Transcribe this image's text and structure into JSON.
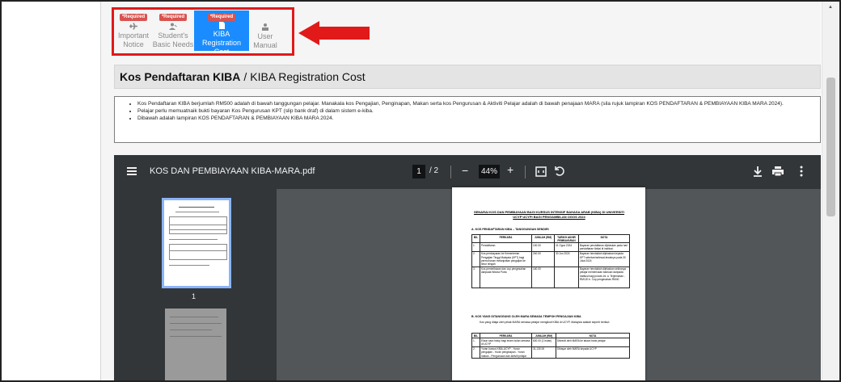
{
  "tabs": [
    {
      "badge": "*Required",
      "label_1": "Important",
      "label_2": "Notice",
      "icon": "plane-icon",
      "active": false
    },
    {
      "badge": "*Required",
      "label_1": "Student's",
      "label_2": "Basic Needs",
      "icon": "user-icon",
      "active": false
    },
    {
      "badge": "*Required",
      "label_1": "KIBA",
      "label_2": "Registration Cost",
      "icon": "document-icon",
      "active": true
    },
    {
      "badge": "",
      "label_1": "User",
      "label_2": "Manual",
      "icon": "user-manual-icon",
      "active": false
    }
  ],
  "title": {
    "bold": "Kos Pendaftaran KIBA",
    "sep": "/",
    "rest": "KIBA Registration Cost"
  },
  "info": {
    "items": [
      "Kos Pendaftaran KIBA berjumlah RM500 adalah di bawah tanggungan pelajar. Manakala kos Pengajian, Penginapan, Makan serta kos Pengurusan & Aktiviti Pelajar adalah di bawah penajaan MARA (sila rujuk lampiran KOS PENDAFTARAN & PEMBIAYAAN KIBA MARA 2024).",
      "Pelajar perlu memuatnaik bukti bayaran Kos Pengurusan KPT (slip bank draf) di dalam sistem e-kiba.",
      "Dibawah adalah lampiran KOS PENDAFTARAN & PEMBIAYAAN KIBA MARA 2024."
    ]
  },
  "pdf": {
    "filename": "KOS DAN PEMBIAYAAN KIBA-MARA.pdf",
    "current_page": "1",
    "total_pages": "/ 2",
    "zoom": "44%",
    "zoom_minus": "−",
    "zoom_plus": "+",
    "thumb_label": "1",
    "page": {
      "title": "SENARAI KOS DAN PEMBIAYAAN BAGI KURSUS INTENSIF BAHASA ARAB (KIBA) DI UNIVERSITI UCYP UCYPI BAGI PENGAMBILAN OGOS 2024",
      "section_a": "A.   KOS PENDAFTARAN KIBA – TANGGUNGAN SENDIRI",
      "table_a_headers": [
        "BIL",
        "PERKARA",
        "JUMLAH (RM)",
        "TARIKH AKHIR PEMBAYARAN",
        "NOTA"
      ],
      "table_a_rows": [
        [
          "1.",
          "Pendaftaran",
          "100.00",
          "01 Ogos 2024",
          "Bayaran pendaftaran dijelaskan pada hari pendaftaran fizikal di institusi."
        ],
        [
          "2.",
          "Kos pembayaran ke Kementerian Pengajian Tinggi Malaysia (KPT) bagi permohonan melanjutkan pengajian ke timur tengah",
          "240.00",
          "30 Jun 2024",
          "Bayaran hendaklah dijelaskan kepada KPT sebelum/selewat-lewatnya pada 30 Julai 2024"
        ],
        [
          "3.",
          "Kos pemeriksaan dan cop pengesahan daripada Wisma Putra",
          "160.00",
          "",
          "Bayaran hendaklah dijelaskan sekiranya pelajar memerlukan bantuan daripada institusi bagi proses ini: a. Terjemahan - RM120 b. Cop pengesahan RM40"
        ]
      ],
      "section_b": "B.   KOS YANG DITANGGUNG OLEH MARA SEMASA TEMPOH PENGAJIAN KIBA",
      "section_b_text": "Kos yang ditaja oleh pihak MARA semasa pelajar mengikuti KIBA di UCYP, Malaysia adalah seperti berikut:",
      "table_b_headers": [
        "BIL",
        "PERKARA",
        "JUMLAH (RM)",
        "NOTA"
      ],
      "table_b_rows": [
        [
          "1.",
          "Elaun sara hidup bagi enam bulan semasa di UCYP",
          "600.00 (1 bulan)",
          "Dikredit oleh MARA ke akaun bank pelajar"
        ],
        [
          "2.",
          "Yuran kursus KIBA-UCYP - Yuran pengajian - Yuran penginapan - Yuran makan - Pengurusan dan aktiviti pelajar",
          "31,130.00",
          "Dibayar oleh MARA kepada UCYP"
        ]
      ]
    }
  },
  "colors": {
    "active_tab": "#1a8cff",
    "badge": "#d9534f",
    "highlight": "#e11919",
    "toolbar": "#323639"
  }
}
